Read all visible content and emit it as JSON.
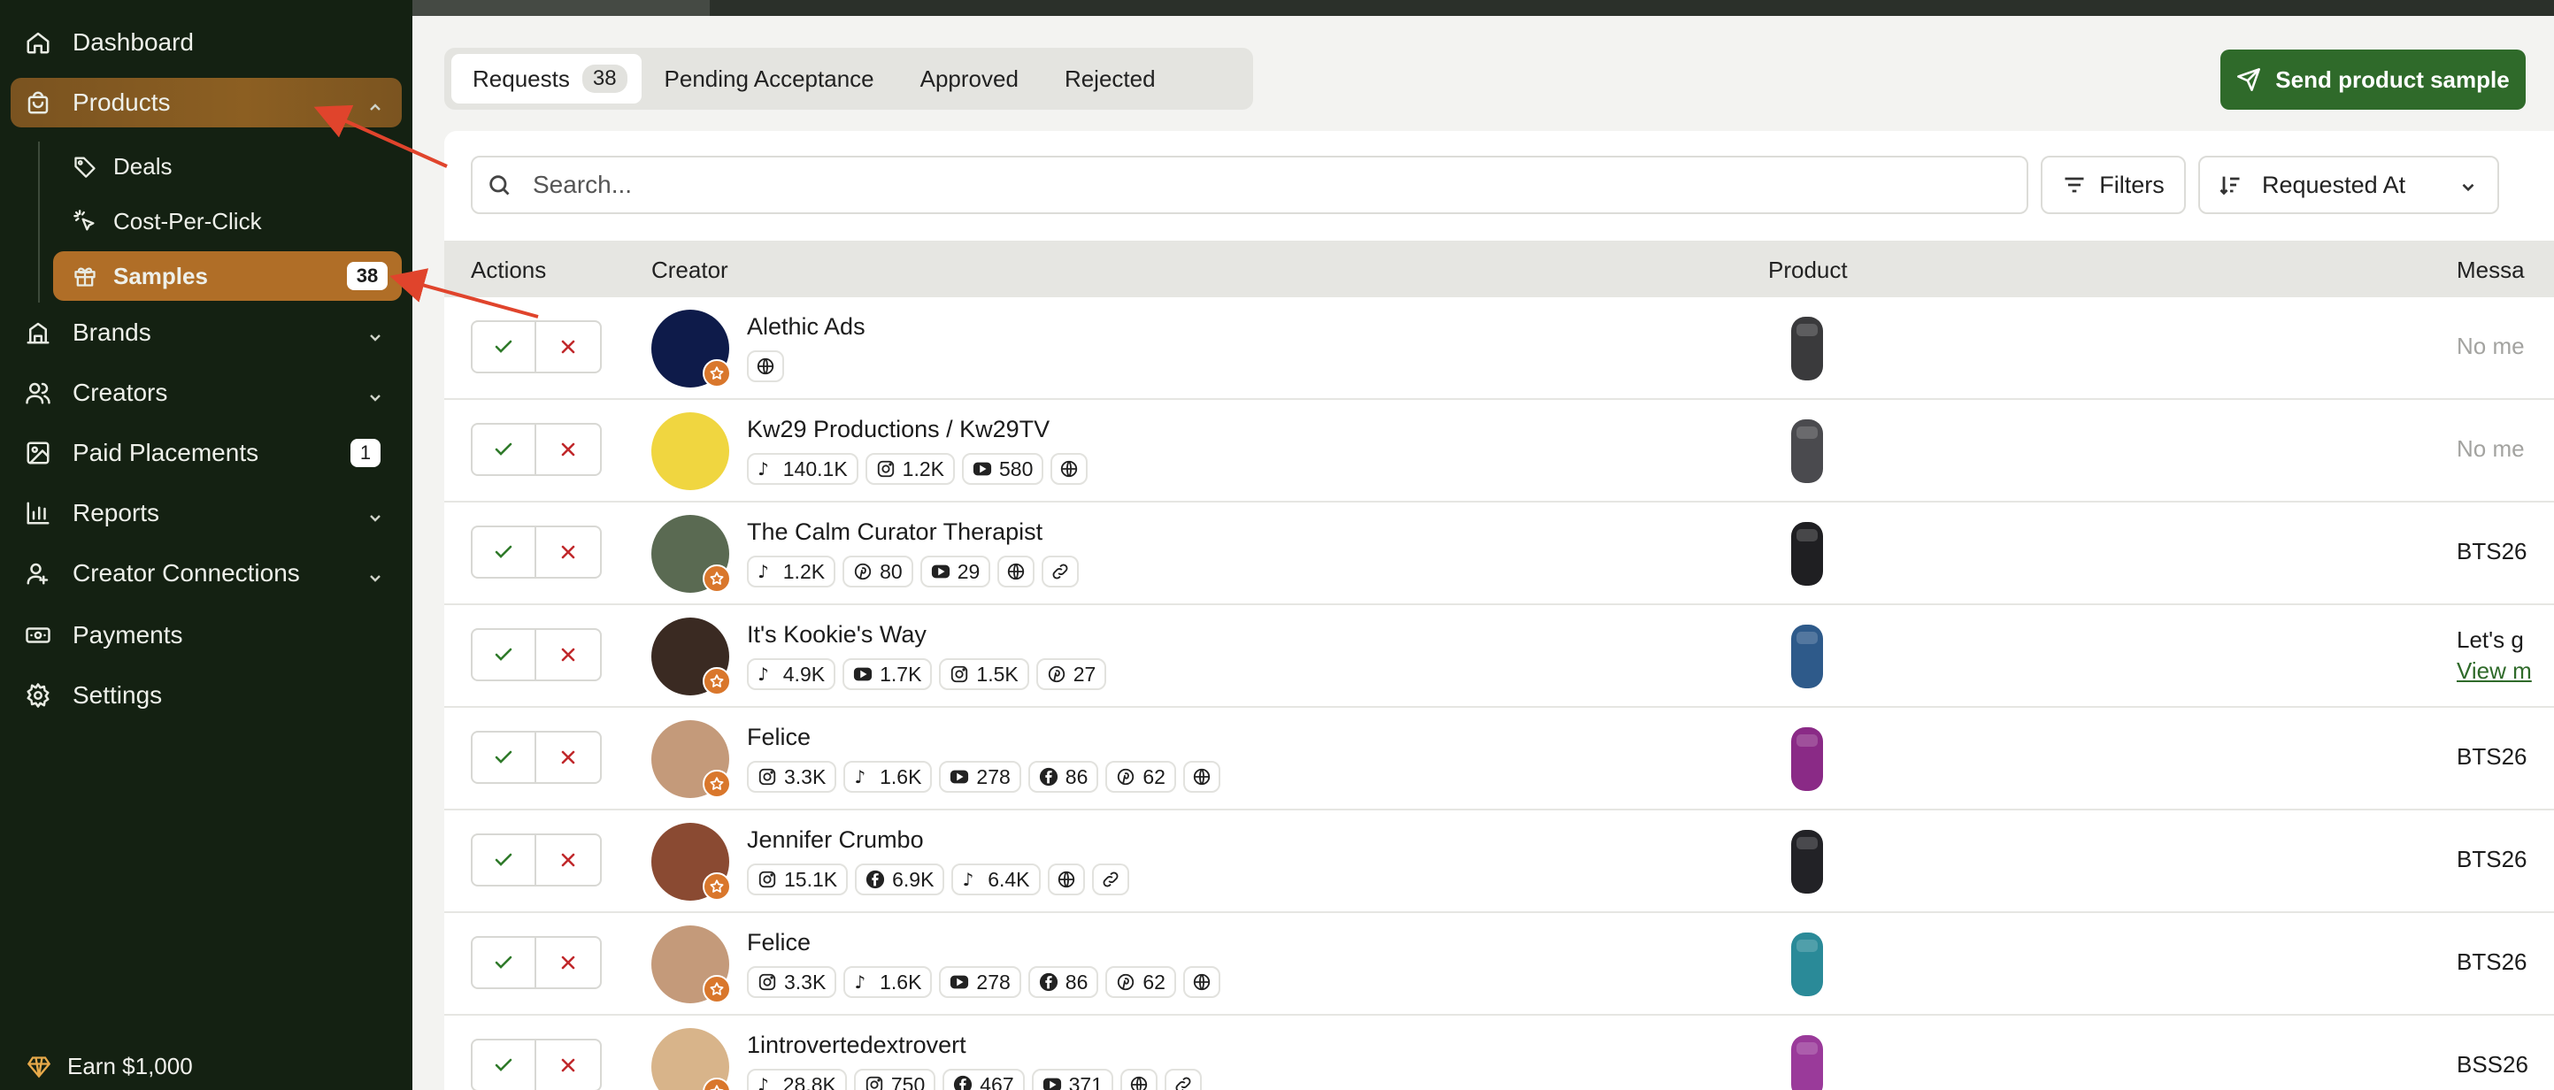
{
  "sidebar": {
    "items": [
      {
        "label": "Dashboard",
        "icon": "home-icon"
      },
      {
        "label": "Products",
        "icon": "shopping-bag-icon"
      },
      {
        "label": "Brands",
        "icon": "building-icon"
      },
      {
        "label": "Creators",
        "icon": "users-icon"
      },
      {
        "label": "Paid Placements",
        "icon": "image-icon",
        "badge": "1"
      },
      {
        "label": "Reports",
        "icon": "bar-chart-icon"
      },
      {
        "label": "Creator Connections",
        "icon": "user-connect-icon"
      },
      {
        "label": "Payments",
        "icon": "wallet-icon"
      },
      {
        "label": "Settings",
        "icon": "gear-icon"
      }
    ],
    "sub_items": [
      {
        "label": "Deals",
        "icon": "tag-icon"
      },
      {
        "label": "Cost-Per-Click",
        "icon": "cursor-click-icon"
      },
      {
        "label": "Samples",
        "icon": "gift-icon",
        "badge": "38"
      }
    ],
    "earn_label": "Earn $1,000"
  },
  "tabs": [
    {
      "label": "Requests",
      "count": "38"
    },
    {
      "label": "Pending Acceptance"
    },
    {
      "label": "Approved"
    },
    {
      "label": "Rejected"
    }
  ],
  "send_button_label": "Send product sample",
  "search": {
    "placeholder": "Search..."
  },
  "filters_label": "Filters",
  "sort_label": "Requested At",
  "table": {
    "headers": {
      "actions": "Actions",
      "creator": "Creator",
      "product": "Product",
      "message": "Messa"
    },
    "rows": [
      {
        "name": "Alethic Ads",
        "avatar_text": "Alethic Ads",
        "starred": true,
        "socials": [
          {
            "icon": "globe-icon"
          }
        ],
        "message": "No me",
        "message_muted": true,
        "product_color": "#3a3a3c"
      },
      {
        "name": "Kw29 Productions / Kw29TV",
        "starred": false,
        "socials": [
          {
            "icon": "tiktok-icon",
            "value": "140.1K"
          },
          {
            "icon": "instagram-icon",
            "value": "1.2K"
          },
          {
            "icon": "youtube-icon",
            "value": "580"
          },
          {
            "icon": "globe-icon"
          }
        ],
        "message": "No me",
        "message_muted": true,
        "product_color": "#4a4a4e"
      },
      {
        "name": "The Calm Curator Therapist",
        "starred": true,
        "socials": [
          {
            "icon": "tiktok-icon",
            "value": "1.2K"
          },
          {
            "icon": "pinterest-icon",
            "value": "80"
          },
          {
            "icon": "youtube-icon",
            "value": "29"
          },
          {
            "icon": "globe-icon"
          },
          {
            "icon": "link-icon"
          }
        ],
        "message": "BTS26",
        "message_muted": false,
        "product_color": "#1f1f22"
      },
      {
        "name": "It's Kookie's Way",
        "starred": true,
        "socials": [
          {
            "icon": "tiktok-icon",
            "value": "4.9K"
          },
          {
            "icon": "youtube-icon",
            "value": "1.7K"
          },
          {
            "icon": "instagram-icon",
            "value": "1.5K"
          },
          {
            "icon": "pinterest-icon",
            "value": "27"
          }
        ],
        "message": "Let's g",
        "message_link": "View m",
        "message_muted": false,
        "product_color": "#2e5a8a"
      },
      {
        "name": "Felice",
        "starred": true,
        "socials": [
          {
            "icon": "instagram-icon",
            "value": "3.3K"
          },
          {
            "icon": "tiktok-icon",
            "value": "1.6K"
          },
          {
            "icon": "youtube-icon",
            "value": "278"
          },
          {
            "icon": "facebook-icon",
            "value": "86"
          },
          {
            "icon": "pinterest-icon",
            "value": "62"
          },
          {
            "icon": "globe-icon"
          }
        ],
        "message": "BTS26",
        "message_muted": false,
        "product_color": "#8a2a86"
      },
      {
        "name": "Jennifer Crumbo",
        "starred": true,
        "socials": [
          {
            "icon": "instagram-icon",
            "value": "15.1K"
          },
          {
            "icon": "facebook-icon",
            "value": "6.9K"
          },
          {
            "icon": "tiktok-icon",
            "value": "6.4K"
          },
          {
            "icon": "globe-icon"
          },
          {
            "icon": "link-icon"
          }
        ],
        "message": "BTS26",
        "message_muted": false,
        "product_color": "#222226"
      },
      {
        "name": "Felice",
        "starred": true,
        "socials": [
          {
            "icon": "instagram-icon",
            "value": "3.3K"
          },
          {
            "icon": "tiktok-icon",
            "value": "1.6K"
          },
          {
            "icon": "youtube-icon",
            "value": "278"
          },
          {
            "icon": "facebook-icon",
            "value": "86"
          },
          {
            "icon": "pinterest-icon",
            "value": "62"
          },
          {
            "icon": "globe-icon"
          }
        ],
        "message": "BTS26",
        "message_muted": false,
        "product_color": "#2a8a98"
      },
      {
        "name": "1introvertedextrovert",
        "starred": true,
        "socials": [
          {
            "icon": "tiktok-icon",
            "value": "28.8K"
          },
          {
            "icon": "instagram-icon",
            "value": "750"
          },
          {
            "icon": "facebook-icon",
            "value": "467"
          },
          {
            "icon": "youtube-icon",
            "value": "371"
          },
          {
            "icon": "globe-icon"
          },
          {
            "icon": "link-icon"
          }
        ],
        "message": "BSS26",
        "message_muted": false,
        "product_color": "#9a3a9a"
      }
    ]
  },
  "colors": {
    "sidebar_bg": "#142112",
    "accent_orange": "#b06e27",
    "primary_green": "#2f6a2a",
    "reject_red": "#c0282b",
    "annotation_arrow": "#e0442c"
  }
}
